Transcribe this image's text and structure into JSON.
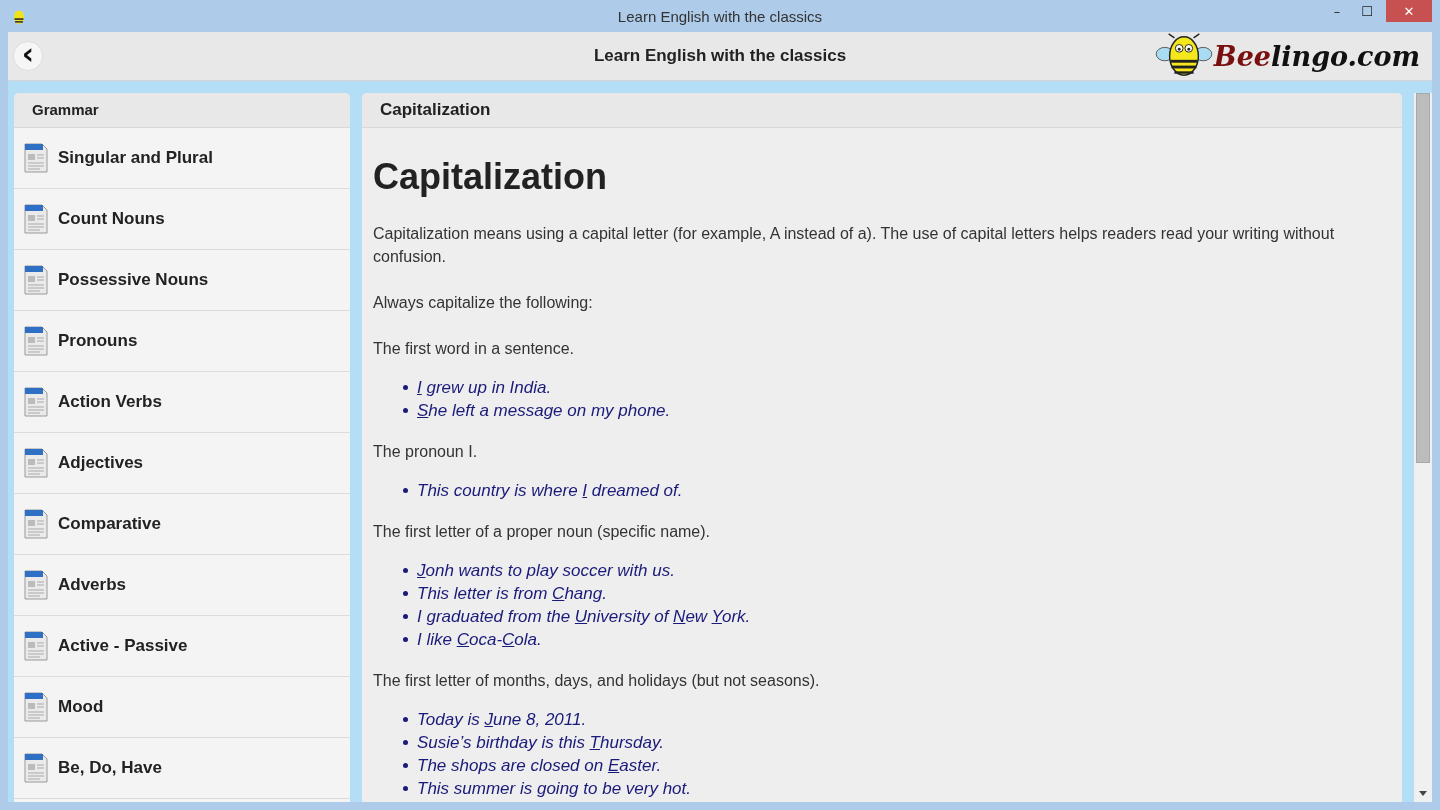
{
  "window": {
    "title": "Learn English with the classics",
    "controls": [
      "–",
      "☐",
      "✕"
    ]
  },
  "header": {
    "back": "‹",
    "title": "Learn English with the classics",
    "logo": {
      "accent": "Bee",
      "rest": "lingo.com"
    }
  },
  "sidebar": {
    "title": "Grammar",
    "items": [
      {
        "label": "Singular and Plural",
        "selected": false
      },
      {
        "label": "Count Nouns",
        "selected": false
      },
      {
        "label": "Possessive Nouns",
        "selected": false
      },
      {
        "label": "Pronouns",
        "selected": false
      },
      {
        "label": "Action Verbs",
        "selected": false
      },
      {
        "label": "Adjectives",
        "selected": false
      },
      {
        "label": "Comparative",
        "selected": false
      },
      {
        "label": "Adverbs",
        "selected": false
      },
      {
        "label": "Active - Passive",
        "selected": false
      },
      {
        "label": "Mood",
        "selected": false
      },
      {
        "label": "Be, Do, Have",
        "selected": false
      }
    ]
  },
  "article": {
    "panel_title": "Capitalization",
    "heading": "Capitalization",
    "blocks": [
      {
        "kind": "paragraph",
        "text": "Capitalization means using a capital letter (for example, A instead of a). The use of capital letters helps readers read your writing without confusion."
      },
      {
        "kind": "paragraph",
        "text": "Always capitalize the following:"
      },
      {
        "kind": "paragraph",
        "text": "The first word in a sentence."
      },
      {
        "kind": "list",
        "items": [
          [
            {
              "text": "I",
              "underlined": true
            },
            {
              "text": " grew up in India",
              "underlined": false
            },
            {
              "text": ".",
              "underlined": false
            }
          ],
          [
            {
              "text": "S",
              "underlined": true
            },
            {
              "text": "he left a message on my phone.",
              "underlined": false
            }
          ]
        ]
      },
      {
        "kind": "paragraph",
        "text": "The pronoun I."
      },
      {
        "kind": "list",
        "items": [
          [
            {
              "text": "This country is where ",
              "underlined": false
            },
            {
              "text": "I",
              "underlined": true
            },
            {
              "text": " dreamed of.",
              "underlined": false
            }
          ]
        ]
      },
      {
        "kind": "paragraph",
        "text": "The first letter of a proper noun (specific name)."
      },
      {
        "kind": "list",
        "items": [
          [
            {
              "text": "J",
              "underlined": true
            },
            {
              "text": "onh wants to play soccer with us.",
              "underlined": false
            }
          ],
          [
            {
              "text": "This letter is from ",
              "underlined": false
            },
            {
              "text": "C",
              "underlined": true
            },
            {
              "text": "hang.",
              "underlined": false
            }
          ],
          [
            {
              "text": "I graduated from the ",
              "underlined": false
            },
            {
              "text": "U",
              "underlined": true
            },
            {
              "text": "niversity of ",
              "underlined": false
            },
            {
              "text": "N",
              "underlined": true
            },
            {
              "text": "ew ",
              "underlined": false
            },
            {
              "text": "Y",
              "underlined": true
            },
            {
              "text": "ork.",
              "underlined": false
            }
          ],
          [
            {
              "text": "I like ",
              "underlined": false
            },
            {
              "text": "C",
              "underlined": true
            },
            {
              "text": "oca-",
              "underlined": false
            },
            {
              "text": "C",
              "underlined": true
            },
            {
              "text": "ola.",
              "underlined": false
            }
          ]
        ]
      },
      {
        "kind": "paragraph",
        "text": "The first letter of months, days, and holidays (but not seasons)."
      },
      {
        "kind": "list",
        "items": [
          [
            {
              "text": "Today is ",
              "underlined": false
            },
            {
              "text": "J",
              "underlined": true
            },
            {
              "text": "une 8, 2011.",
              "underlined": false
            }
          ],
          [
            {
              "text": "Susie’s birthday is this ",
              "underlined": false
            },
            {
              "text": "T",
              "underlined": true
            },
            {
              "text": "hursday.",
              "underlined": false
            }
          ],
          [
            {
              "text": "The shops are closed on ",
              "underlined": false
            },
            {
              "text": "E",
              "underlined": true
            },
            {
              "text": "aster.",
              "underlined": false
            }
          ],
          [
            {
              "text": "This summer is going to be very hot.",
              "underlined": false
            }
          ]
        ]
      }
    ]
  }
}
